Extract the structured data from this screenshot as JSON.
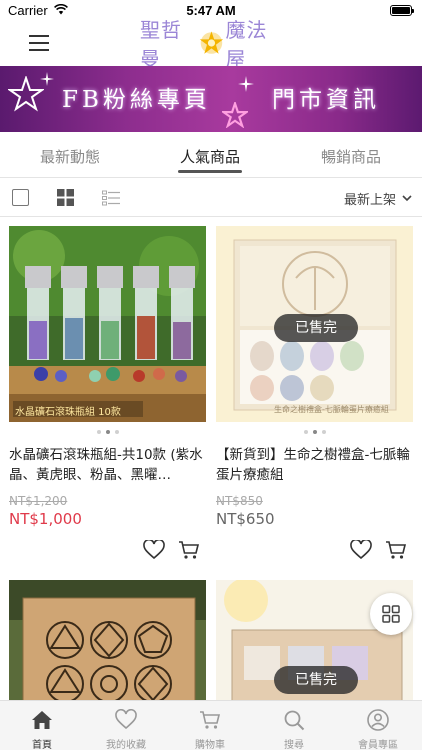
{
  "status_bar": {
    "carrier": "Carrier",
    "time": "5:47 AM"
  },
  "header": {
    "logo_left": "聖哲曼",
    "logo_right": "魔法屋"
  },
  "banner": {
    "left_text": "FB粉絲專頁",
    "right_text": "門市資訊"
  },
  "tabs": [
    {
      "label": "最新動態",
      "active": false
    },
    {
      "label": "人氣商品",
      "active": true
    },
    {
      "label": "暢銷商品",
      "active": false
    }
  ],
  "toolbar": {
    "sort_label": "最新上架"
  },
  "products": [
    {
      "title": "水晶礦石滾珠瓶組-共10款 (紫水晶、黃虎眼、粉晶、黑曜…",
      "image_caption": "水晶礦石滾珠瓶組 10款",
      "price_original": "NT$1,200",
      "price": "NT$1,000",
      "sold_out": false
    },
    {
      "title": "【新貨到】生命之樹禮盒-七脈輪蛋片療癒組",
      "image_caption": "生命之樹禮盒-七脈輪蛋片療癒組",
      "price_original": "NT$850",
      "price": "NT$650",
      "sold_out": true,
      "sold_label": "已售完"
    },
    {
      "sold_out": false
    },
    {
      "sold_out": true,
      "sold_label": "已售完"
    }
  ],
  "bottom_nav": [
    {
      "label": "首頁",
      "icon": "home-icon",
      "active": true
    },
    {
      "label": "我的收藏",
      "icon": "heart-icon",
      "active": false
    },
    {
      "label": "購物車",
      "icon": "cart-icon",
      "active": false
    },
    {
      "label": "搜尋",
      "icon": "search-icon",
      "active": false
    },
    {
      "label": "會員專區",
      "icon": "user-icon",
      "active": false
    }
  ],
  "colors": {
    "accent_price": "#e03a4a",
    "banner_purple": "#8d2d8e",
    "logo_purple": "#9b86d6"
  }
}
